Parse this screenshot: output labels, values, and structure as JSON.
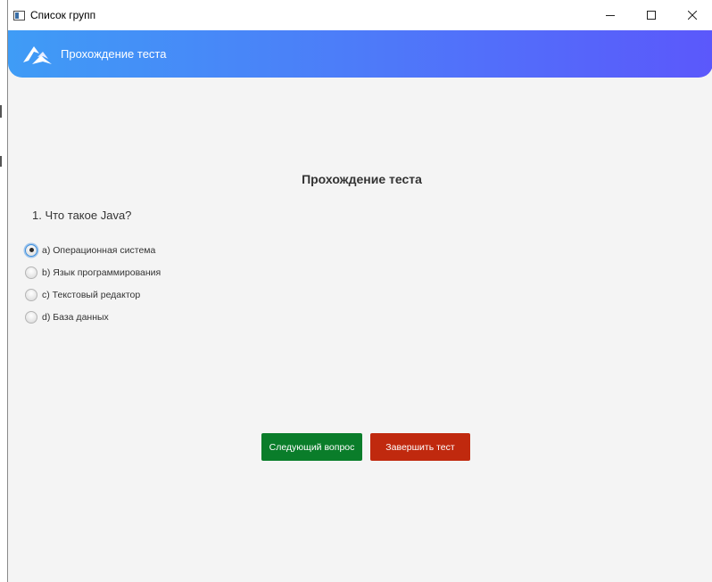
{
  "window": {
    "title": "Список групп",
    "controls": [
      "minimize-icon",
      "maximize-icon",
      "close-icon"
    ]
  },
  "header": {
    "logo_icon": "brand-logo-icon",
    "title": "Прохождение теста",
    "gradient_start": "#3f9cf6",
    "gradient_end": "#5b58fb"
  },
  "main": {
    "test_title": "Прохождение теста",
    "question": "1. Что такое Java?",
    "options": [
      {
        "label": "a) Операционная система",
        "selected": true
      },
      {
        "label": "b) Язык программирования",
        "selected": false
      },
      {
        "label": "c) Текстовый редактор",
        "selected": false
      },
      {
        "label": "d) База данных",
        "selected": false
      }
    ]
  },
  "buttons": {
    "next_label": "Следующий вопрос",
    "next_color": "#0a7d2a",
    "finish_label": "Завершить тест",
    "finish_color": "#c0290e"
  }
}
